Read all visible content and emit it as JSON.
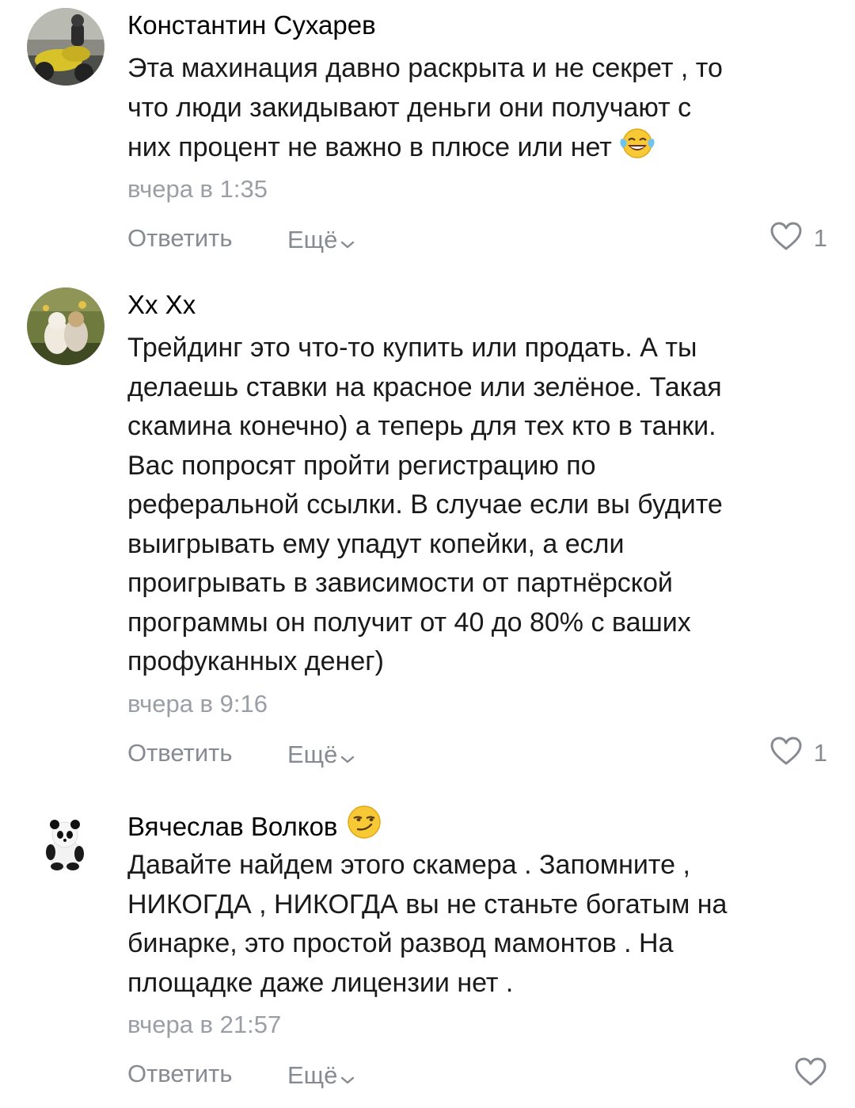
{
  "comments": [
    {
      "author": "Константин Сухарев",
      "text_lines": [
        "Эта махинация давно раскрыта и не секрет , то",
        "что люди закидывают деньги они получают с",
        "них процент не важно в плюсе или нет"
      ],
      "text_emoji": "tears-of-joy-emoji",
      "time": "вчера в 1:35",
      "reply_label": "Ответить",
      "more_label": "Ещё",
      "likes": "1"
    },
    {
      "author": "Хх Хх",
      "text_lines": [
        "Трейдинг это что-то купить или продать. А ты",
        "делаешь ставки на красное или зелёное. Такая",
        "скамина конечно) а теперь для тех кто в танки.",
        "Вас попросят пройти регистрацию по",
        "реферальной ссылки. В случае если вы будите",
        "выигрывать ему упадут копейки, а если",
        "проигрывать в зависимости от партнёрской",
        "программы он получит от 40 до 80% с ваших",
        "профуканных денег)"
      ],
      "time": "вчера в 9:16",
      "reply_label": "Ответить",
      "more_label": "Ещё",
      "likes": "1"
    },
    {
      "author": "Вячеслав Волков",
      "author_emoji": "smirk-emoji",
      "text_lines": [
        "Давайте найдем этого скамера . Запомните ,",
        "НИКОГДА , НИКОГДА вы не станьте богатым на",
        "бинарке, это простой развод мамонтов . На",
        "площадке даже лицензии нет ."
      ],
      "time": "вчера в 21:57",
      "reply_label": "Ответить",
      "more_label": "Ещё",
      "likes": ""
    }
  ],
  "colors": {
    "secondary_text": "#868b92",
    "timestamp": "#9a9fa6",
    "heart_outline": "#868b92"
  }
}
